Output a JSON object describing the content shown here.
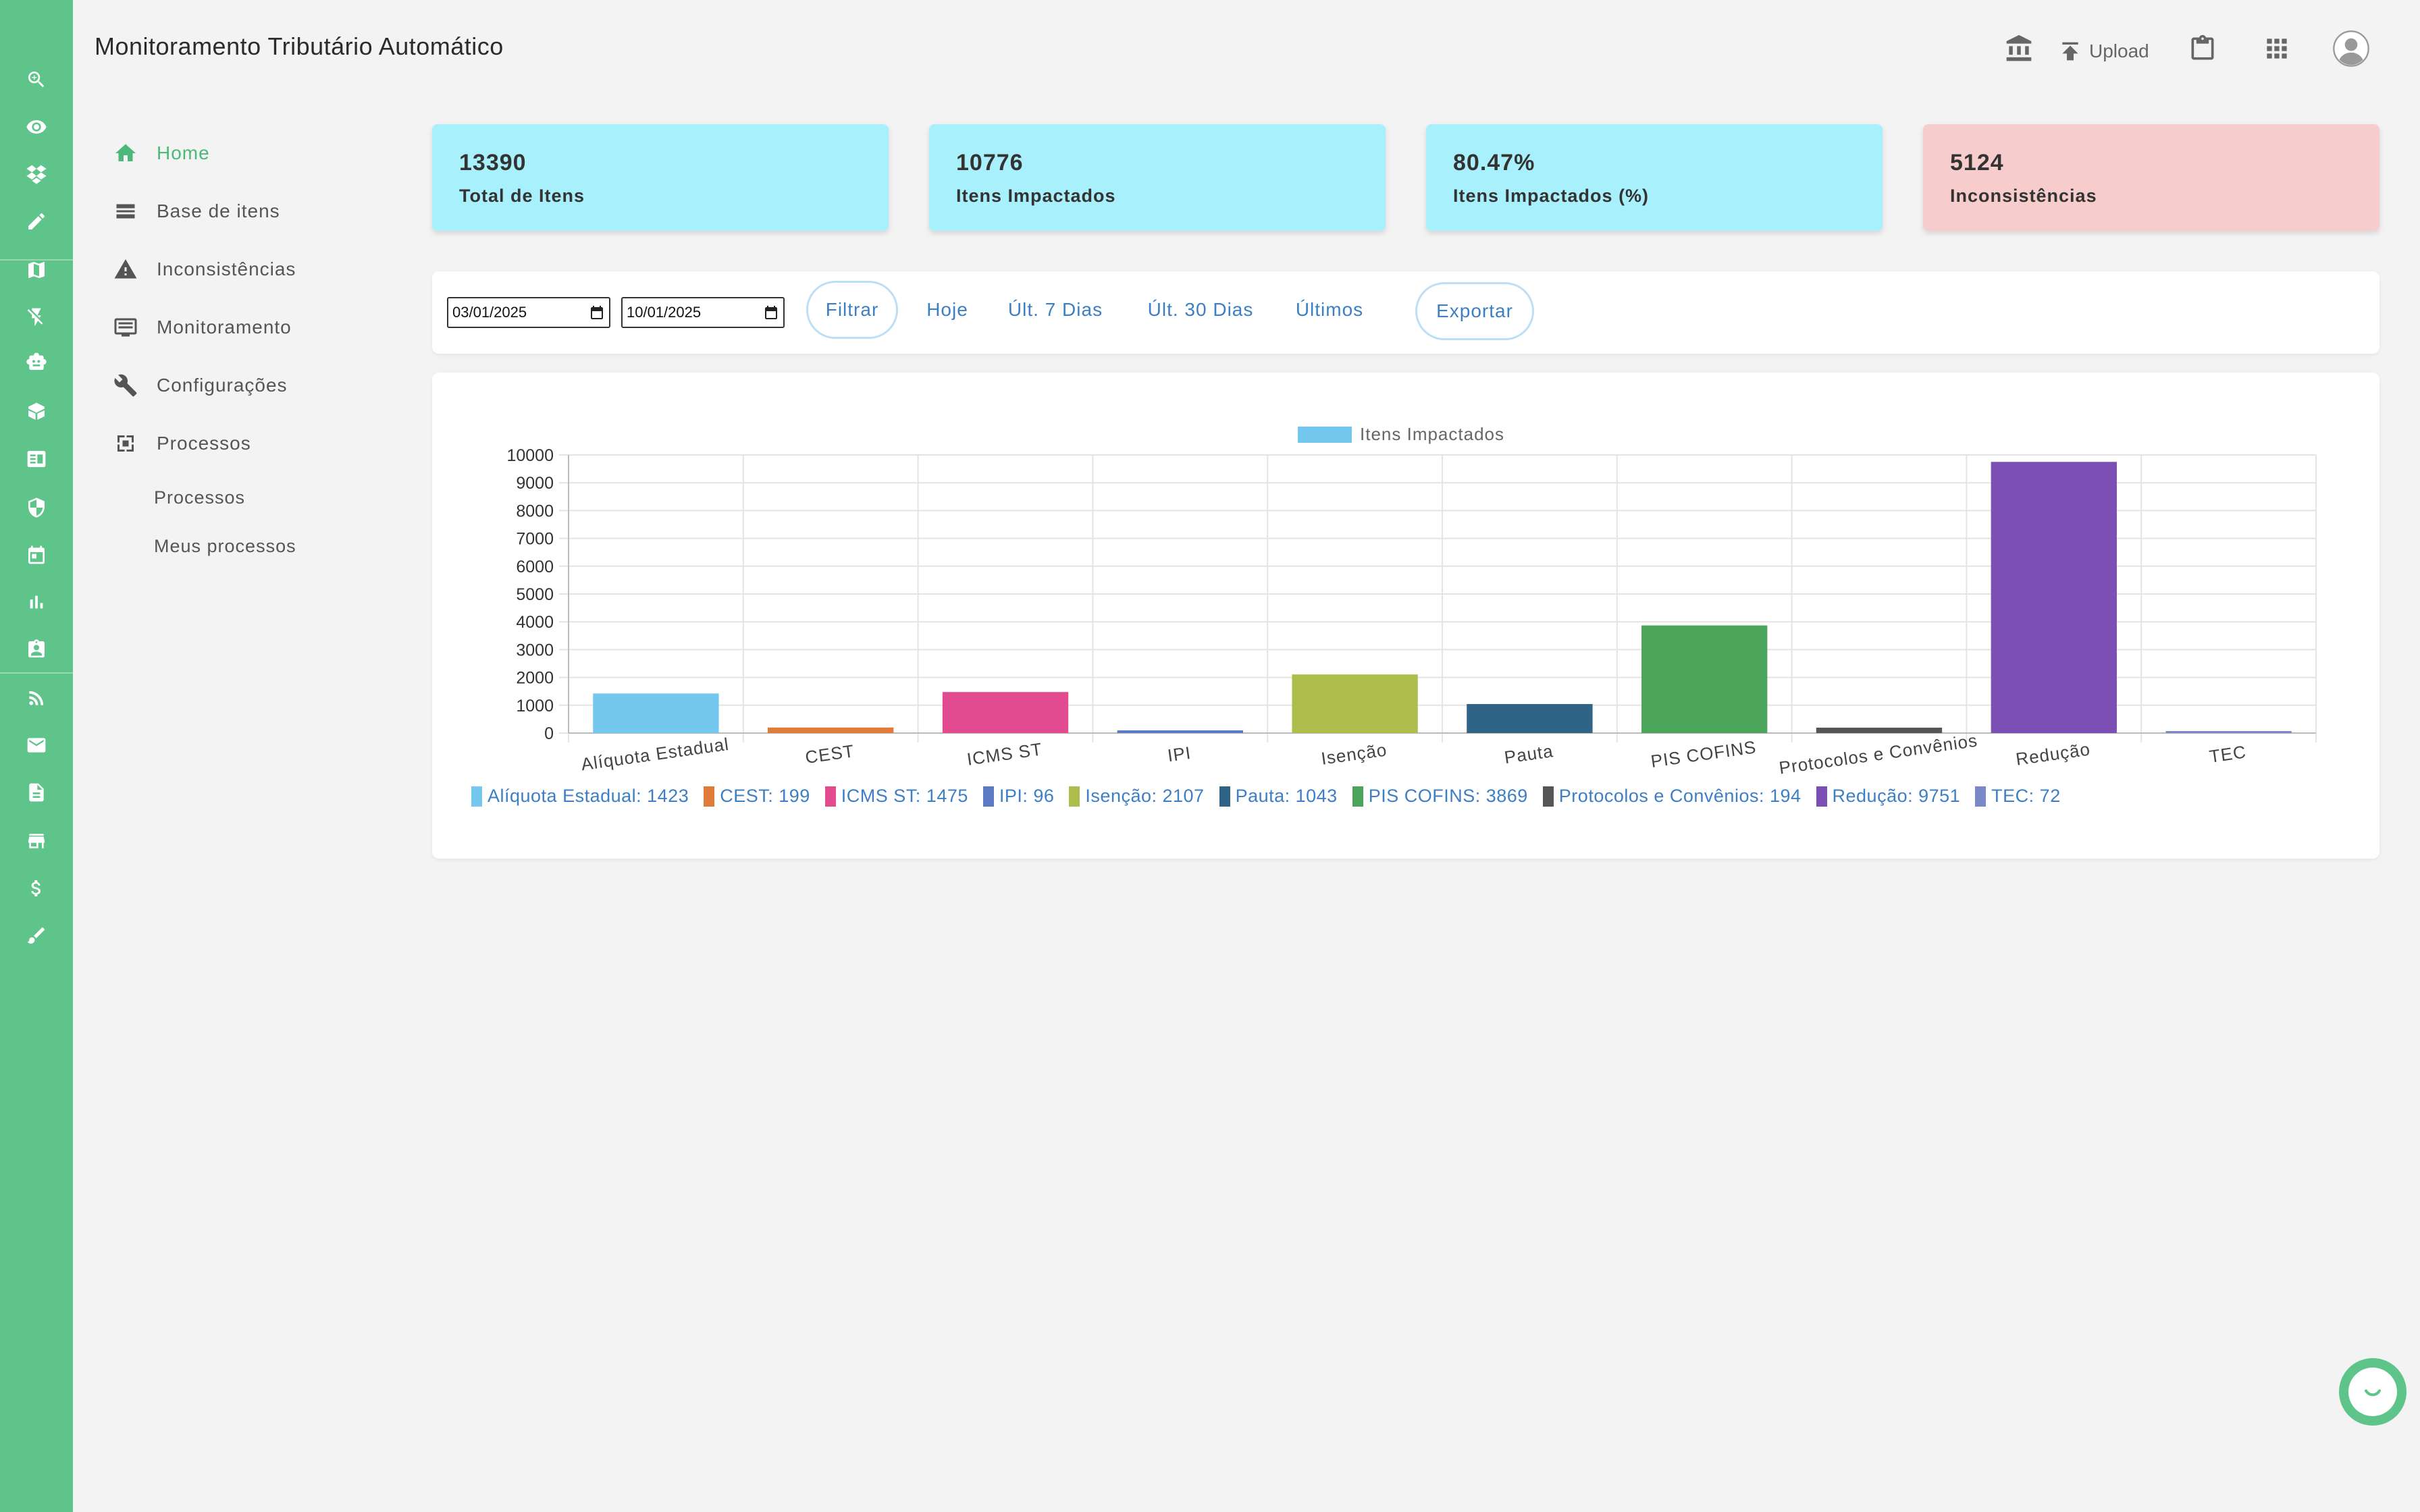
{
  "app": {
    "title": "Monitoramento Tributário Automático"
  },
  "header": {
    "upload_label": "Upload"
  },
  "rail_icons": [
    "search-icon",
    "eye-icon",
    "dropbox-icon",
    "pencil-icon",
    "map-icon",
    "flash-off-icon",
    "robot-icon",
    "box-icon",
    "newspaper-icon",
    "shield-icon",
    "calendar-icon",
    "bar-chart-icon",
    "badge-icon",
    "rss-icon",
    "mail-icon",
    "document-icon",
    "store-icon",
    "dollar-icon",
    "brush-icon"
  ],
  "sidebar": {
    "items": [
      {
        "label": "Home",
        "icon": "home-icon",
        "active": true
      },
      {
        "label": "Base de itens",
        "icon": "table-icon"
      },
      {
        "label": "Inconsistências",
        "icon": "warning-icon"
      },
      {
        "label": "Monitoramento",
        "icon": "monitor-icon"
      },
      {
        "label": "Configurações",
        "icon": "wrench-icon"
      },
      {
        "label": "Processos",
        "icon": "process-icon"
      }
    ],
    "subitems": [
      {
        "label": "Processos"
      },
      {
        "label": "Meus processos"
      }
    ]
  },
  "cards": [
    {
      "value": "13390",
      "label": "Total de Itens",
      "color": "#a8f0fb"
    },
    {
      "value": "10776",
      "label": "Itens Impactados",
      "color": "#a8f0fb"
    },
    {
      "value": "80.47%",
      "label": "Itens Impactados (%)",
      "color": "#a8f0fb"
    },
    {
      "value": "5124",
      "label": "Inconsistências",
      "color": "#f7cccc"
    }
  ],
  "filters": {
    "start_date": "03/01/2025",
    "end_date": "10/01/2025",
    "filter_label": "Filtrar",
    "today_label": "Hoje",
    "last7_label": "Últ. 7 Dias",
    "last30_label": "Últ. 30 Dias",
    "last_label": "Últimos",
    "export_label": "Exportar"
  },
  "chart_data": {
    "type": "bar",
    "title": "",
    "legend_label": "Itens Impactados",
    "legend_color": "#74c8f0",
    "xlabel": "",
    "ylabel": "",
    "ylim": [
      0,
      10000
    ],
    "yticks": [
      0,
      1000,
      2000,
      3000,
      4000,
      5000,
      6000,
      7000,
      8000,
      9000,
      10000
    ],
    "grid": true,
    "categories": [
      "Alíquota Estadual",
      "CEST",
      "ICMS ST",
      "IPI",
      "Isenção",
      "Pauta",
      "PIS COFINS",
      "Protocolos e Convênios",
      "Redução",
      "TEC"
    ],
    "values": [
      1423,
      199,
      1475,
      96,
      2107,
      1043,
      3869,
      194,
      9751,
      72
    ],
    "colors": [
      "#74c8f0",
      "#e07b39",
      "#e24b8f",
      "#5d7bc4",
      "#adbe4c",
      "#2f6487",
      "#4aa55a",
      "#555555",
      "#7b4fb4",
      "#7a88c8"
    ],
    "bottom_legend": [
      "Alíquota Estadual: 1423",
      "CEST: 199",
      "ICMS ST: 1475",
      "IPI: 96",
      "Isenção: 2107",
      "Pauta: 1043",
      "PIS COFINS: 3869",
      "Protocolos e Convênios: 194",
      "Redução: 9751",
      "TEC: 72"
    ]
  }
}
